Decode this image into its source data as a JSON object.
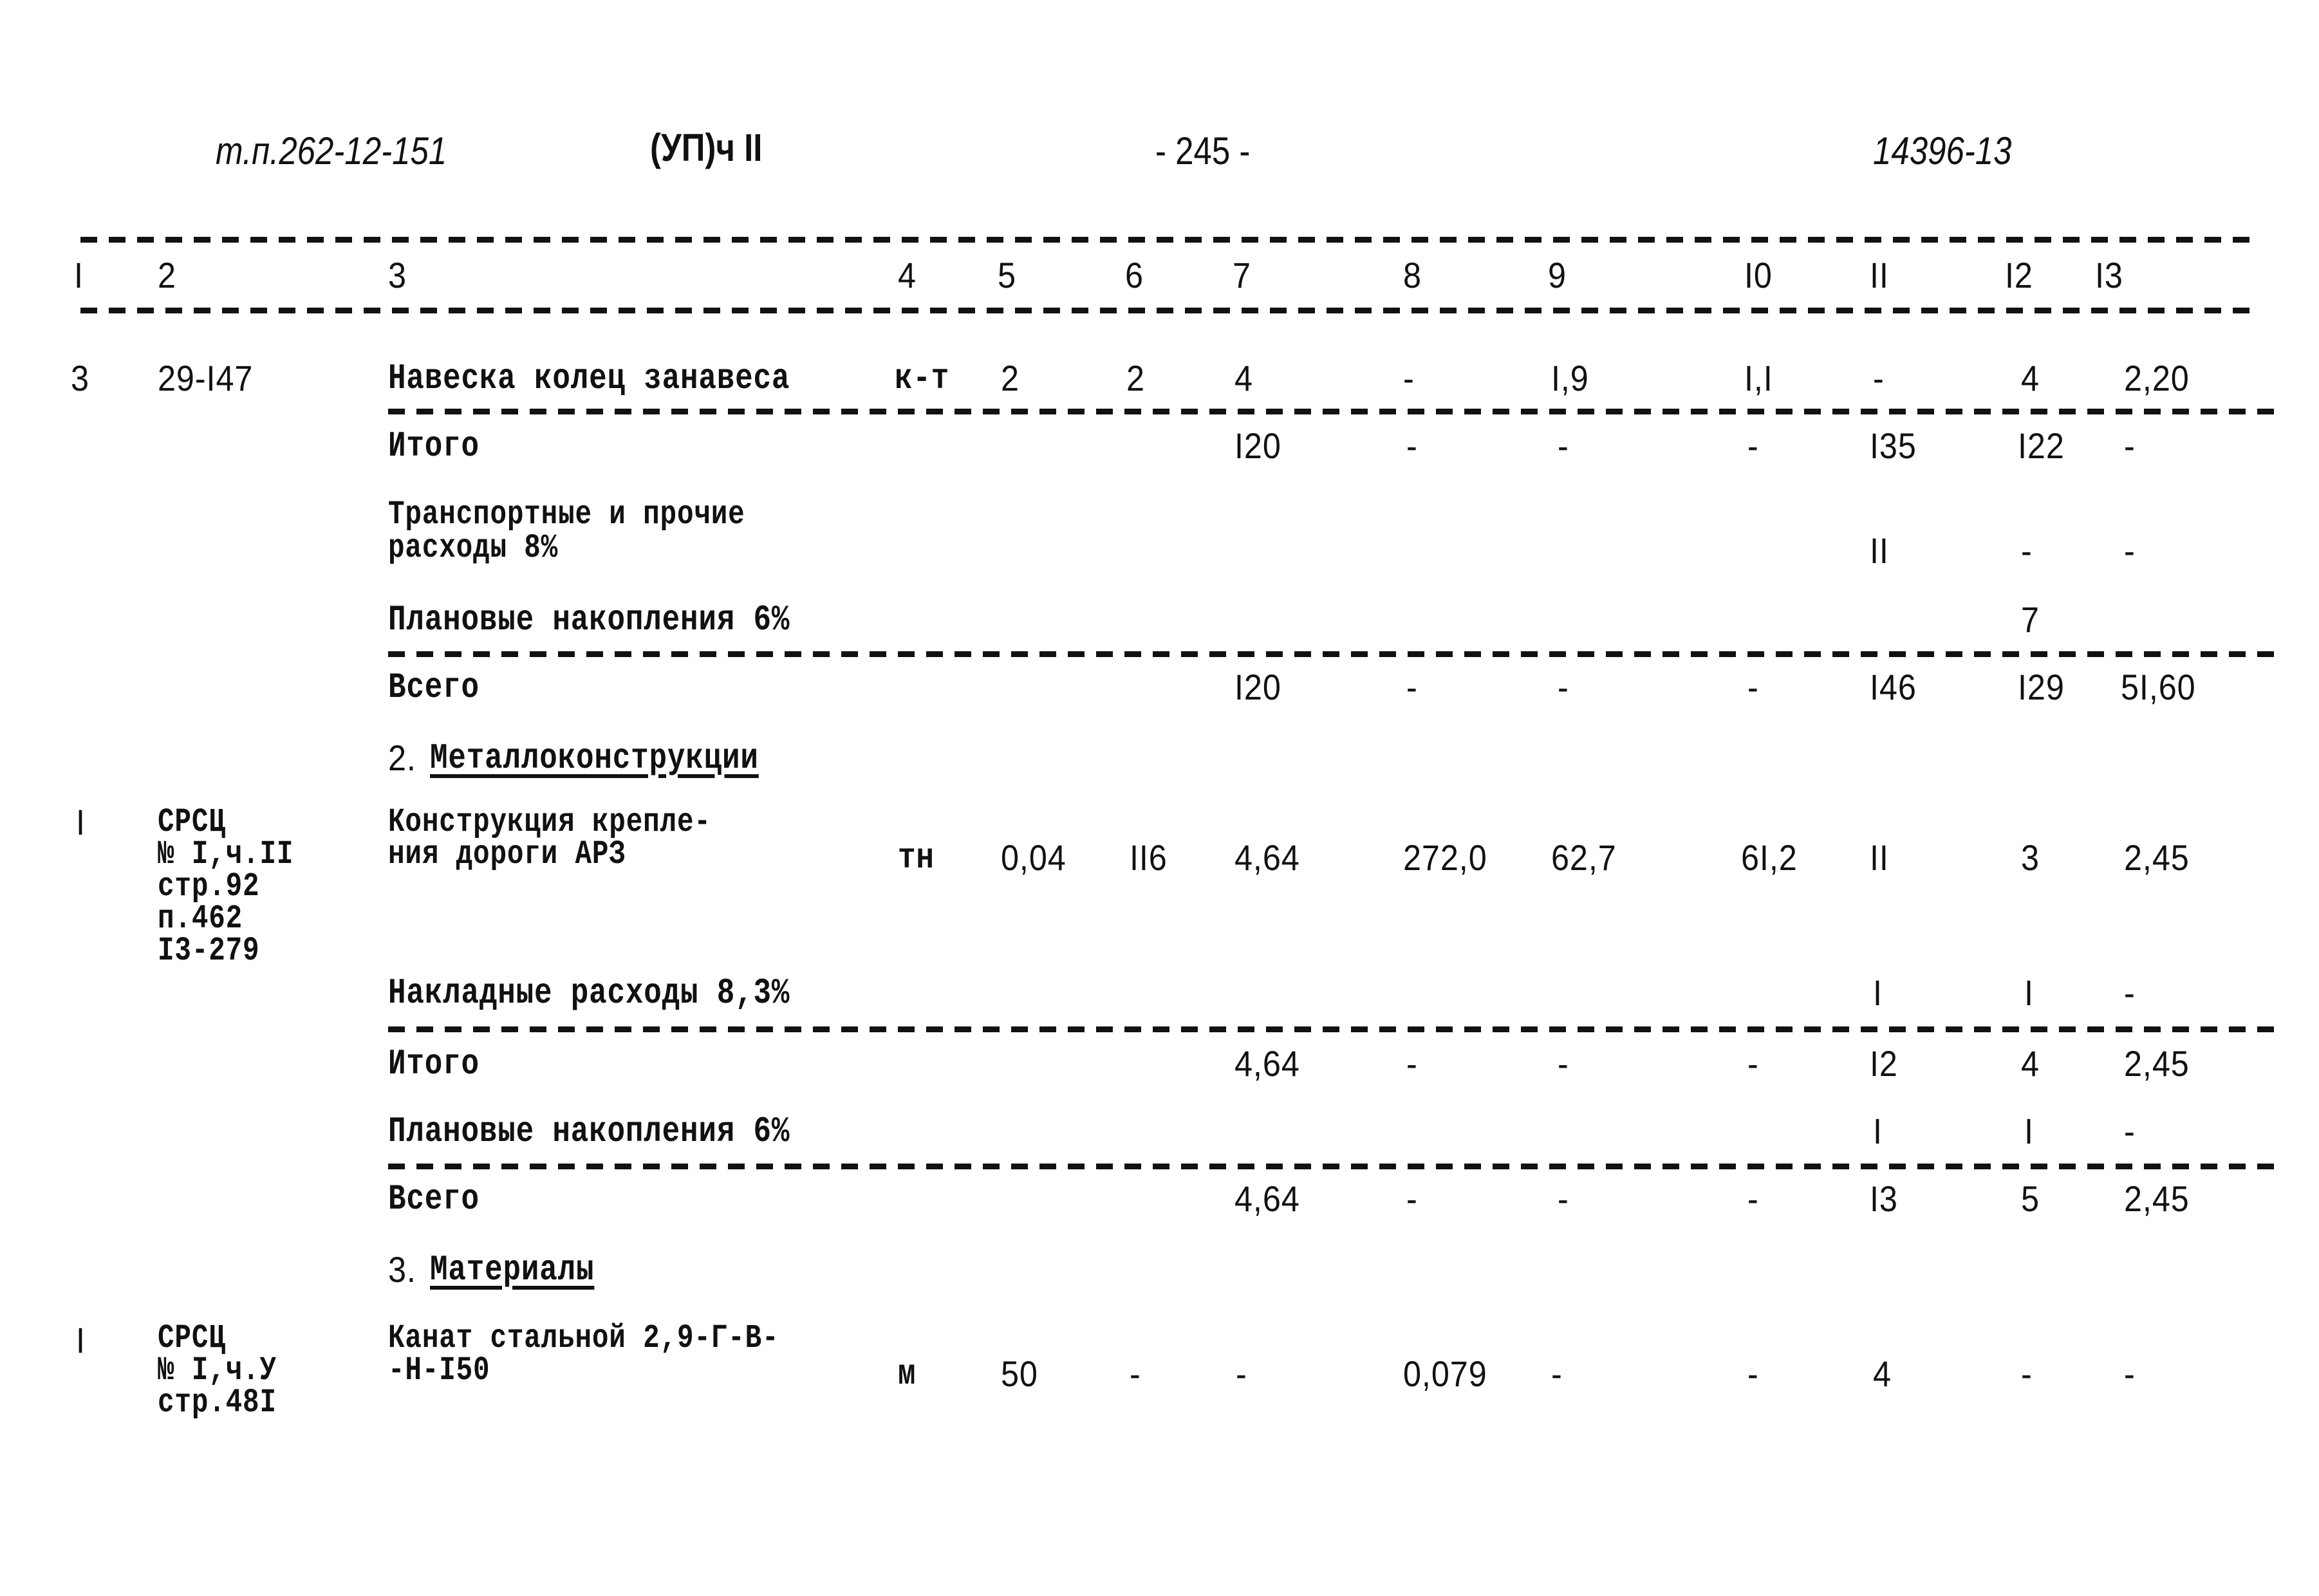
{
  "header": {
    "doc_code": "т.п.262-12-151",
    "volume_mark": "(УП)ч II",
    "page_number": "- 245 -",
    "archive_number": "14396-13"
  },
  "columns": [
    "I",
    "2",
    "3",
    "4",
    "5",
    "6",
    "7",
    "8",
    "9",
    "I0",
    "II",
    "I2",
    "I3"
  ],
  "rows": {
    "r1": {
      "c1": "3",
      "c2": "29-I47",
      "c3": "Навеска колец занавеса",
      "c4": "к-т",
      "c5": "2",
      "c6": "2",
      "c7": "4",
      "c8": "-",
      "c9": "I,9",
      "c10": "I,I",
      "c11": "-",
      "c12": "4",
      "c13": "2,20"
    },
    "r2": {
      "c3": "Итого",
      "c7": "I20",
      "c8": "-",
      "c9": "-",
      "c10": "-",
      "c11": "I35",
      "c12": "I22",
      "c13": "-"
    },
    "r3": {
      "c3a": "Транспортные и прочие",
      "c3b": "расходы 8%",
      "c11": "II",
      "c12": "-",
      "c13": "-"
    },
    "r4": {
      "c3": "Плановые накопления 6%",
      "c12": "7"
    },
    "r5": {
      "c3": "Всего",
      "c7": "I20",
      "c8": "-",
      "c9": "-",
      "c10": "-",
      "c11": "I46",
      "c12": "I29",
      "c13": "5I,60"
    },
    "s2": {
      "num": "2.",
      "title": "Металлоконструкции"
    },
    "r6": {
      "c1": "I",
      "c2a": "СРСЦ",
      "c2b": "№ I,ч.II",
      "c2c": "стр.92",
      "c2d": "п.462",
      "c2e": "I3-279",
      "c3a": "Конструкция крепле-",
      "c3b": "ния дороги АРЗ",
      "c4": "тн",
      "c5": "0,04",
      "c6": "II6",
      "c7": "4,64",
      "c8": "272,0",
      "c9": "62,7",
      "c10": "6I,2",
      "c11": "II",
      "c12": "3",
      "c13": "2,45"
    },
    "r7": {
      "c3": "Накладные расходы 8,3%",
      "c11": "I",
      "c12": "I",
      "c13": "-"
    },
    "r8": {
      "c3": "Итого",
      "c7": "4,64",
      "c8": "-",
      "c9": "-",
      "c10": "-",
      "c11": "I2",
      "c12": "4",
      "c13": "2,45"
    },
    "r9": {
      "c3": "Плановые накопления 6%",
      "c11": "I",
      "c12": "I",
      "c13": "-"
    },
    "r10": {
      "c3": "Всего",
      "c7": "4,64",
      "c8": "-",
      "c9": "-",
      "c10": "-",
      "c11": "I3",
      "c12": "5",
      "c13": "2,45"
    },
    "s3": {
      "num": "3.",
      "title": "Материалы"
    },
    "r11": {
      "c1": "I",
      "c2a": "СРСЦ",
      "c2b": "№ I,ч.У",
      "c2c": "стр.48I",
      "c3a": "Канат стальной 2,9-Г-В-",
      "c3b": "-Н-I50",
      "c4": "м",
      "c5": "50",
      "c6": "-",
      "c7": "-",
      "c8": "0,079",
      "c9": "-",
      "c10": "-",
      "c11": "4",
      "c12": "-",
      "c13": "-"
    }
  }
}
